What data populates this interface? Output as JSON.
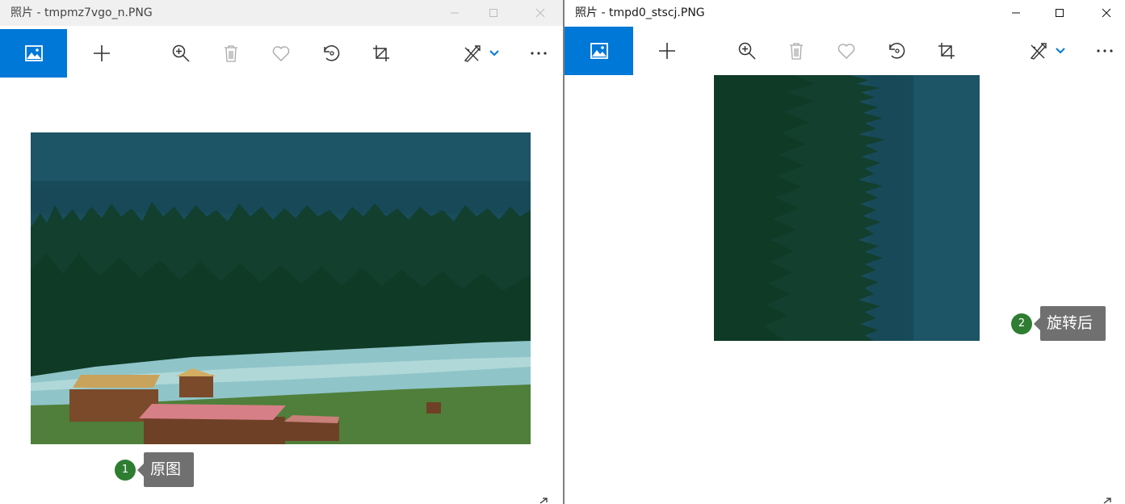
{
  "windows": [
    {
      "id": "left",
      "title": "照片 - tmpmz7vgo_n.PNG",
      "caption_buttons": [
        "minimize",
        "maximize",
        "close"
      ],
      "toolbar": [
        "view-photo-icon",
        "add-icon",
        "zoom-in-icon",
        "delete-icon",
        "favorite-icon",
        "rotate-icon",
        "crop-icon",
        "edit-draw-icon",
        "dropdown-chevron-icon",
        "more-options-icon"
      ],
      "callout": {
        "number": "1",
        "label": "原图"
      }
    },
    {
      "id": "right",
      "title": "照片 - tmpd0_stscj.PNG",
      "caption_buttons": [
        "minimize",
        "maximize",
        "close"
      ],
      "toolbar": [
        "view-photo-icon",
        "add-icon",
        "zoom-in-icon",
        "delete-icon",
        "favorite-icon",
        "rotate-icon",
        "crop-icon",
        "edit-draw-icon",
        "dropdown-chevron-icon",
        "more-options-icon"
      ],
      "callout": {
        "number": "2",
        "label": "旋转后"
      }
    }
  ],
  "colors": {
    "accent": "#0078d7",
    "badge": "#2e7d32",
    "tooltip": "#707070",
    "titlebar_inactive": "#f0f0f0"
  }
}
